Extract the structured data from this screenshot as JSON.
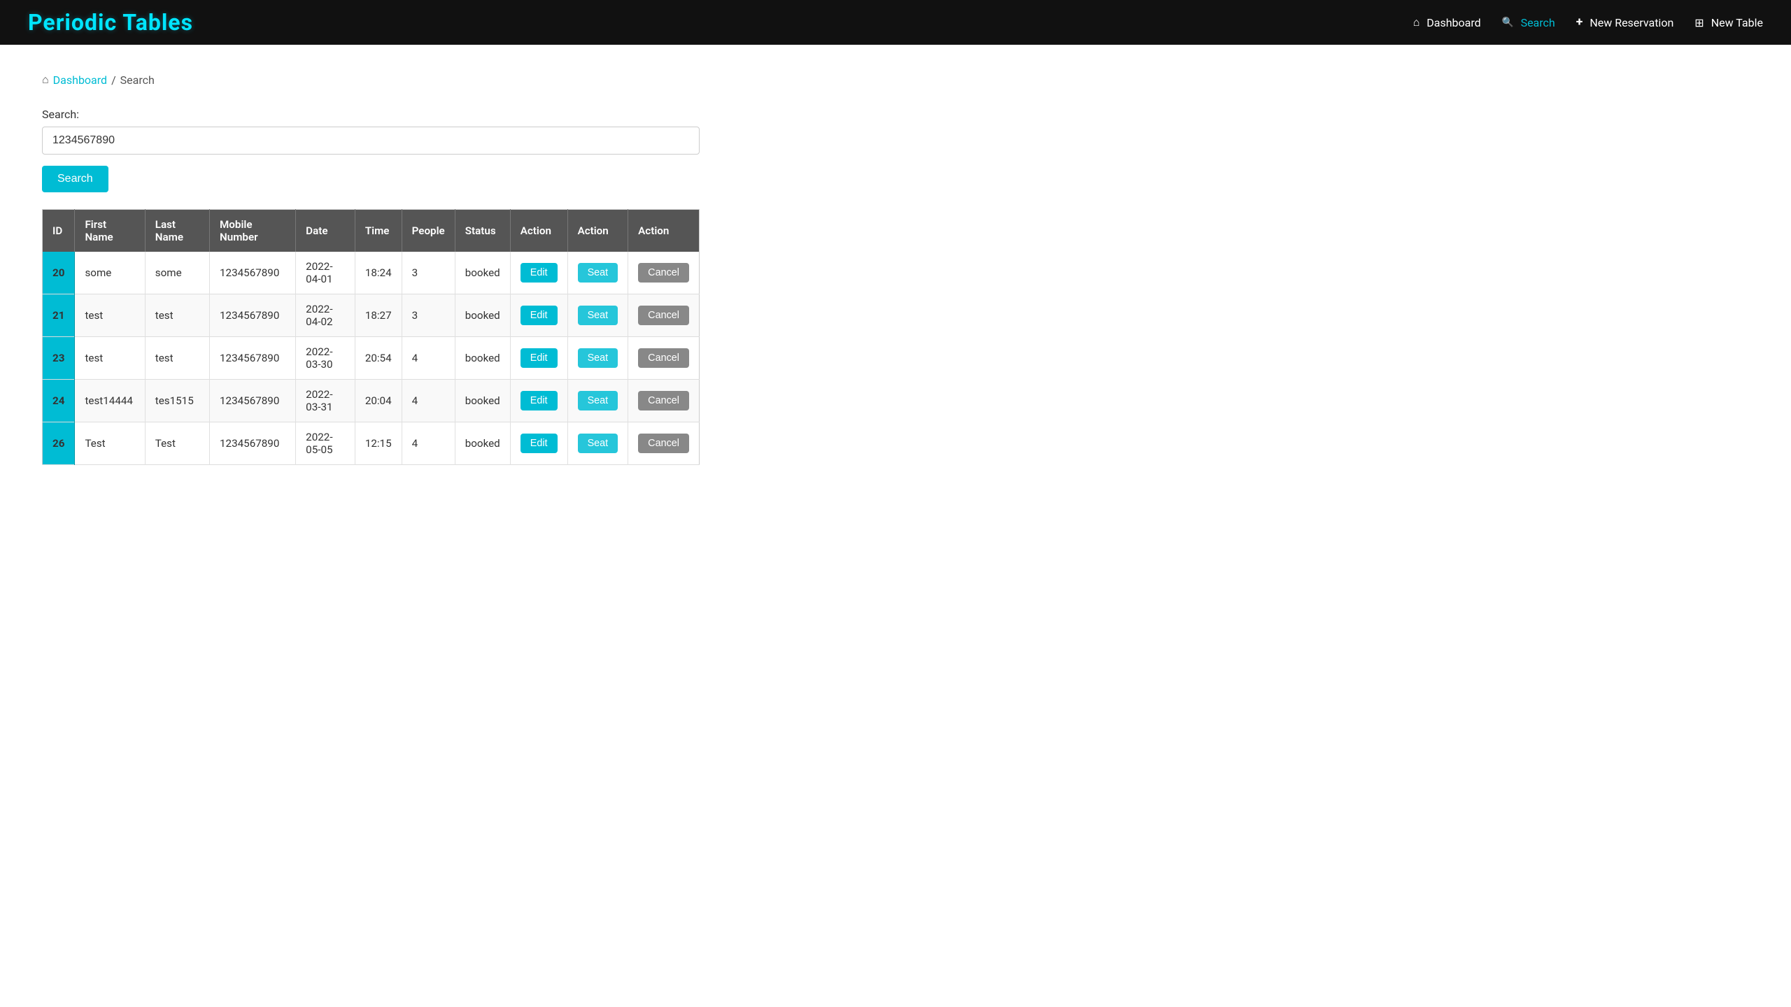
{
  "app": {
    "brand": "Periodic Tables"
  },
  "navbar": {
    "dashboard_label": "Dashboard",
    "search_label": "Search",
    "new_reservation_label": "New Reservation",
    "new_table_label": "New Table"
  },
  "breadcrumb": {
    "home_label": "Dashboard",
    "separator": "/",
    "current": "Search"
  },
  "search_form": {
    "label": "Search:",
    "value": "1234567890",
    "placeholder": "",
    "button_label": "Search"
  },
  "table": {
    "columns": [
      "ID",
      "First Name",
      "Last Name",
      "Mobile Number",
      "Date",
      "Time",
      "People",
      "Status",
      "Action",
      "Action",
      "Action"
    ],
    "rows": [
      {
        "id": "20",
        "first_name": "some",
        "last_name": "some",
        "mobile": "1234567890",
        "date": "2022-04-01",
        "time": "18:24",
        "people": "3",
        "status": "booked",
        "edit_label": "Edit",
        "seat_label": "Seat",
        "cancel_label": "Cancel"
      },
      {
        "id": "21",
        "first_name": "test",
        "last_name": "test",
        "mobile": "1234567890",
        "date": "2022-04-02",
        "time": "18:27",
        "people": "3",
        "status": "booked",
        "edit_label": "Edit",
        "seat_label": "Seat",
        "cancel_label": "Cancel"
      },
      {
        "id": "23",
        "first_name": "test",
        "last_name": "test",
        "mobile": "1234567890",
        "date": "2022-03-30",
        "time": "20:54",
        "people": "4",
        "status": "booked",
        "edit_label": "Edit",
        "seat_label": "Seat",
        "cancel_label": "Cancel"
      },
      {
        "id": "24",
        "first_name": "test14444",
        "last_name": "tes1515",
        "mobile": "1234567890",
        "date": "2022-03-31",
        "time": "20:04",
        "people": "4",
        "status": "booked",
        "edit_label": "Edit",
        "seat_label": "Seat",
        "cancel_label": "Cancel"
      },
      {
        "id": "26",
        "first_name": "Test",
        "last_name": "Test",
        "mobile": "1234567890",
        "date": "2022-05-05",
        "time": "12:15",
        "people": "4",
        "status": "booked",
        "edit_label": "Edit",
        "seat_label": "Seat",
        "cancel_label": "Cancel"
      }
    ]
  }
}
